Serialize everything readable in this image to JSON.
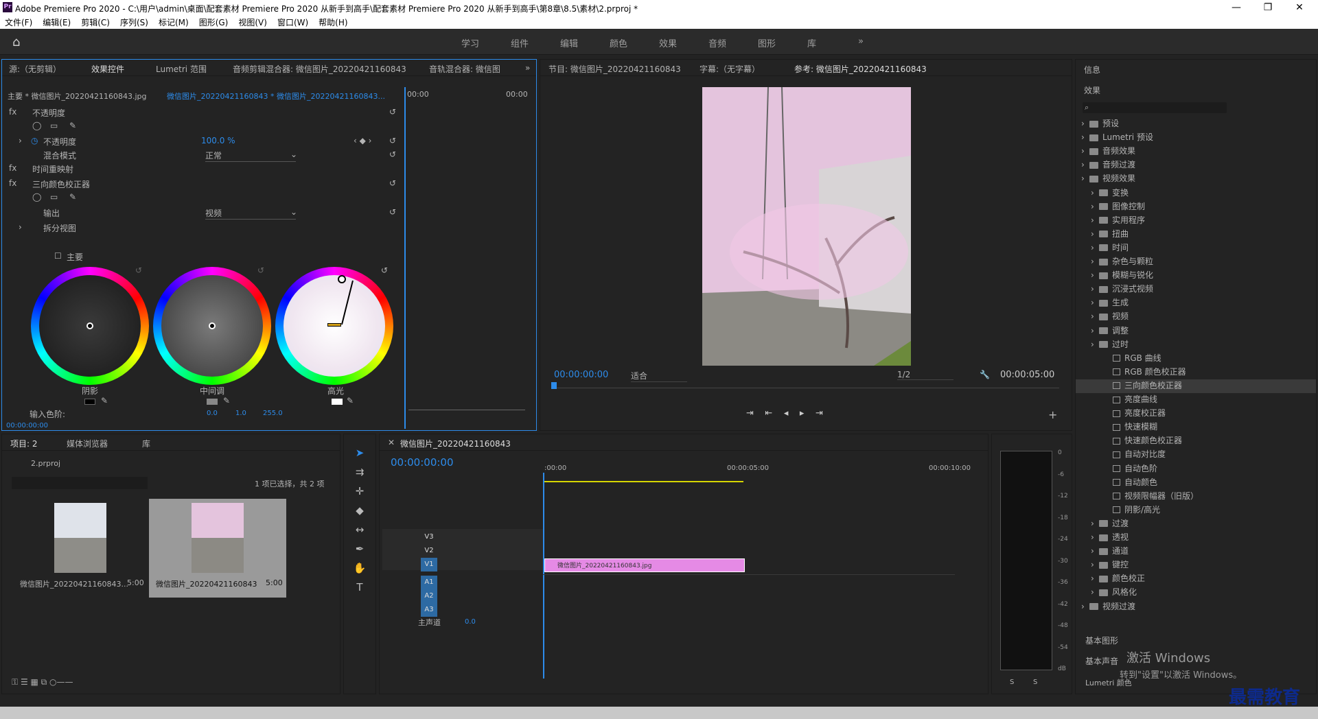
{
  "window": {
    "title": "Adobe Premiere Pro 2020 - C:\\用户\\admin\\桌面\\配套素材 Premiere Pro 2020 从新手到高手\\配套素材 Premiere Pro 2020 从新手到高手\\第8章\\8.5\\素材\\2.prproj *"
  },
  "menu": [
    "文件(F)",
    "编辑(E)",
    "剪辑(C)",
    "序列(S)",
    "标记(M)",
    "图形(G)",
    "视图(V)",
    "窗口(W)",
    "帮助(H)"
  ],
  "workspaces": [
    "学习",
    "组件",
    "编辑",
    "颜色",
    "效果",
    "音频",
    "图形",
    "库"
  ],
  "source_panel": {
    "tabs": [
      "源:（无剪辑）",
      "效果控件",
      "Lumetri 范围",
      "音频剪辑混合器: 微信图片_20220421160843",
      "音轨混合器: 微信图"
    ],
    "master_clip": "主要 * 微信图片_20220421160843.jpg",
    "seq_clip": "微信图片_20220421160843 * 微信图片_20220421160843...",
    "time_left": "00:00",
    "time_right": "00:00",
    "opacity": "不透明度",
    "opacity_prop": "不透明度",
    "opacity_value": "100.0 %",
    "blend": "混合模式",
    "blend_value": "正常",
    "time_remap": "时间重映射",
    "three_way": "三向颜色校正器",
    "output": "输出",
    "output_value": "视频",
    "split": "拆分视图",
    "master": "主要",
    "wheels": [
      "阴影",
      "中间调",
      "高光"
    ],
    "input_levels": "输入色阶:",
    "lv0": "0.0",
    "lv1": "1.0",
    "lv2": "255.0",
    "timecode": "00:00:00:00"
  },
  "program_panel": {
    "tabs": [
      "节目: 微信图片_20220421160843",
      "字幕:（无字幕）",
      "参考: 微信图片_20220421160843"
    ],
    "timecode": "00:00:00:00",
    "fit": "适合",
    "res": "1/2",
    "duration": "00:00:05:00"
  },
  "effects_panel": {
    "info": "信息",
    "title": "效果",
    "items": [
      "预设",
      "Lumetri 预设",
      "音频效果",
      "音频过渡",
      "视频效果",
      "变换",
      "图像控制",
      "实用程序",
      "扭曲",
      "时间",
      "杂色与颗粒",
      "模糊与锐化",
      "沉浸式视频",
      "生成",
      "视频",
      "调整",
      "过时",
      "RGB 曲线",
      "RGB 颜色校正器",
      "三向颜色校正器",
      "亮度曲线",
      "亮度校正器",
      "快速模糊",
      "快速颜色校正器",
      "自动对比度",
      "自动色阶",
      "自动颜色",
      "视频限幅器（旧版）",
      "阴影/高光",
      "过渡",
      "透视",
      "通道",
      "键控",
      "颜色校正",
      "风格化",
      "视频过渡"
    ],
    "basic_graphics": "基本图形",
    "basic_audio": "基本声音",
    "lumetri_color": "Lumetri 颜色",
    "activation": "激活 Windows",
    "activation2": "转到\"设置\"以激活 Windows。"
  },
  "project_panel": {
    "tabs": [
      "项目: 2",
      "媒体浏览器",
      "库"
    ],
    "file": "2.prproj",
    "selection": "1 项已选择，共 2 项",
    "clips": [
      {
        "name": "微信图片_20220421160843...",
        "dur": "5:00"
      },
      {
        "name": "微信图片_20220421160843",
        "dur": "5:00"
      }
    ]
  },
  "timeline": {
    "title": "微信图片_20220421160843",
    "timecode": "00:00:00:00",
    "ruler": [
      ":00:00",
      "00:00:05:00",
      "00:00:10:00"
    ],
    "video_tracks": [
      "V3",
      "V2",
      "V1"
    ],
    "audio_tracks": [
      "A1",
      "A2",
      "A3"
    ],
    "master": "主声道",
    "master_val": "0.0",
    "clip": "微信图片_20220421160843.jpg"
  },
  "meter": {
    "ticks": [
      "0",
      "-6",
      "-12",
      "-18",
      "-24",
      "-30",
      "-36",
      "-42",
      "-48",
      "-54",
      "dB"
    ],
    "s": "S"
  },
  "watermark": "最需教育",
  "colors": {
    "accent": "#2d8ceb",
    "clip": "#e58ae5",
    "yellow": "#d6d600"
  }
}
